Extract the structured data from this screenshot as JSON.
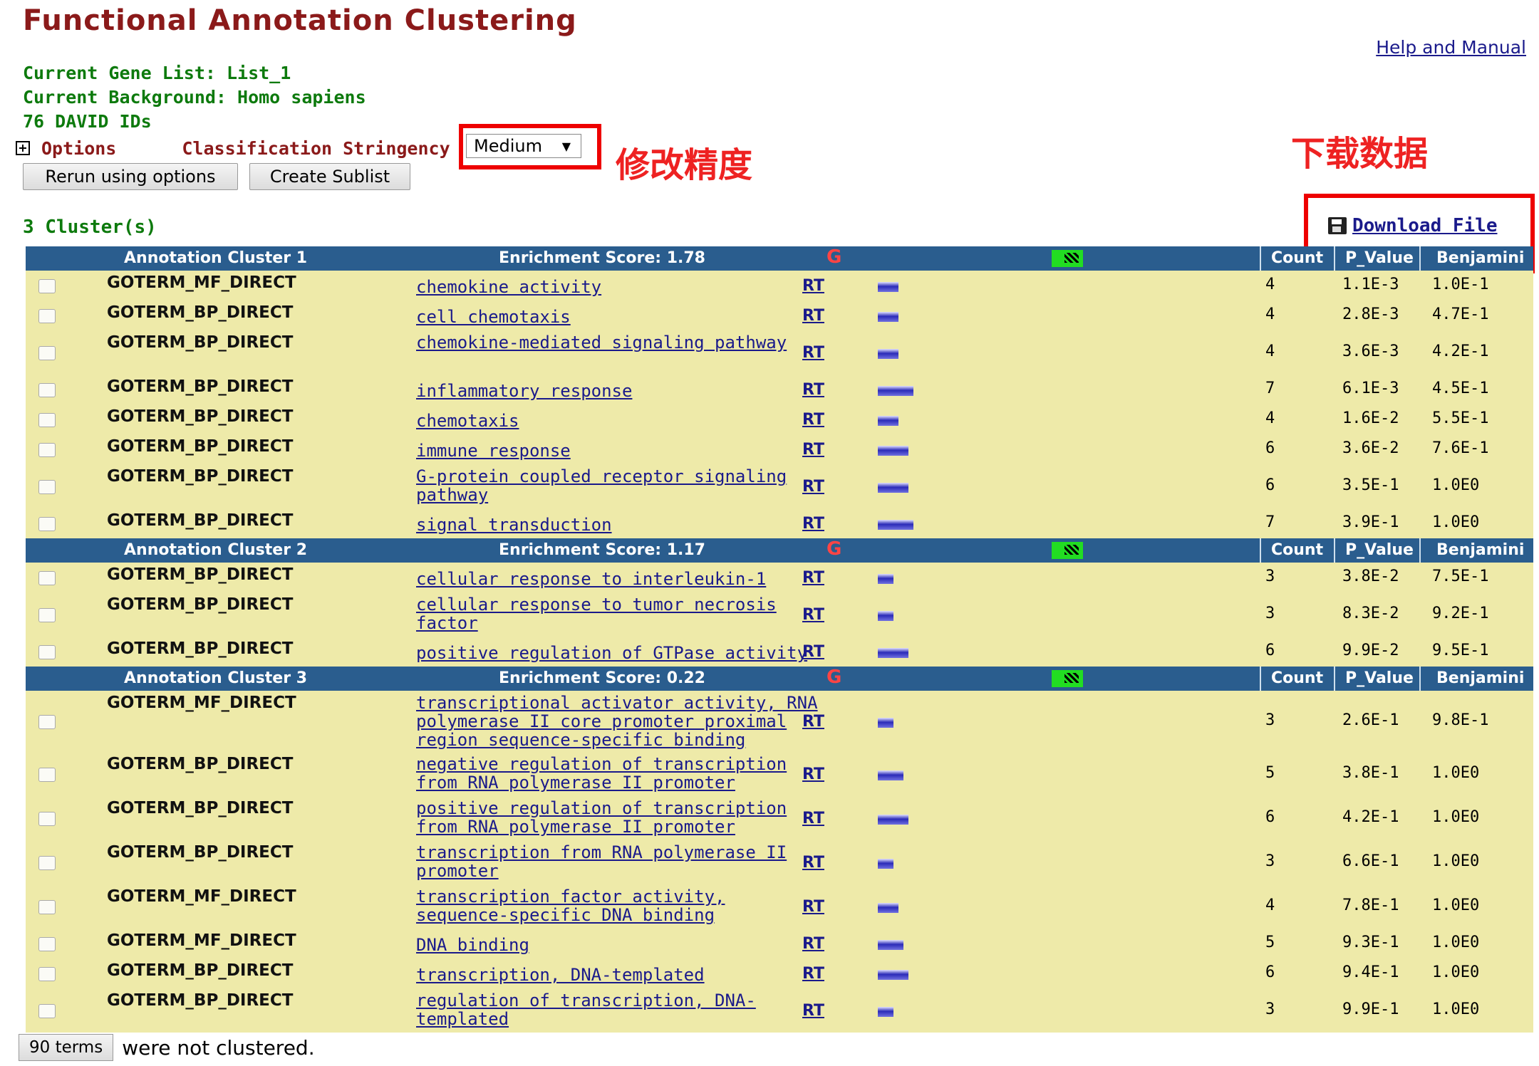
{
  "page_title": "Functional Annotation Clustering",
  "help_link": "Help and Manual",
  "info": {
    "gene_list": "Current Gene List: List_1",
    "background": "Current Background: Homo sapiens",
    "ids": "76 DAVID IDs"
  },
  "options": {
    "label": "Options",
    "stringency_label": "Classification Stringency",
    "stringency_value": "Medium"
  },
  "buttons": {
    "rerun": "Rerun using options",
    "sublist": "Create Sublist"
  },
  "annotations": {
    "modify_precision": "修改精度",
    "download_data": "下载数据"
  },
  "clusters_count": "3 Cluster(s)",
  "download_label": "Download File",
  "column_headers": {
    "count": "Count",
    "p_value": "P_Value",
    "benjamini": "Benjamini"
  },
  "accent_colors": {
    "header_bg": "#2a5d8e",
    "row_bg": "#eeeaa9",
    "title": "#8b1a1a",
    "info": "#0d7a0d",
    "annotation": "#e22222"
  },
  "clusters": [
    {
      "name": "Annotation Cluster 1",
      "score": "Enrichment Score: 1.78",
      "rows": [
        {
          "category": "GOTERM_MF_DIRECT",
          "term": "chemokine activity",
          "rt": "RT",
          "count": "4",
          "p_value": "1.1E-3",
          "benjamini": "1.0E-1"
        },
        {
          "category": "GOTERM_BP_DIRECT",
          "term": "cell chemotaxis",
          "rt": "RT",
          "count": "4",
          "p_value": "2.8E-3",
          "benjamini": "4.7E-1"
        },
        {
          "category": "GOTERM_BP_DIRECT",
          "term": "chemokine-mediated signaling pathway",
          "rt": "RT",
          "count": "4",
          "p_value": "3.6E-3",
          "benjamini": "4.2E-1"
        },
        {
          "category": "GOTERM_BP_DIRECT",
          "term": "inflammatory response",
          "rt": "RT",
          "count": "7",
          "p_value": "6.1E-3",
          "benjamini": "4.5E-1"
        },
        {
          "category": "GOTERM_BP_DIRECT",
          "term": "chemotaxis",
          "rt": "RT",
          "count": "4",
          "p_value": "1.6E-2",
          "benjamini": "5.5E-1"
        },
        {
          "category": "GOTERM_BP_DIRECT",
          "term": "immune response",
          "rt": "RT",
          "count": "6",
          "p_value": "3.6E-2",
          "benjamini": "7.6E-1"
        },
        {
          "category": "GOTERM_BP_DIRECT",
          "term": "G-protein coupled receptor signaling pathway",
          "rt": "RT",
          "count": "6",
          "p_value": "3.5E-1",
          "benjamini": "1.0E0"
        },
        {
          "category": "GOTERM_BP_DIRECT",
          "term": "signal transduction",
          "rt": "RT",
          "count": "7",
          "p_value": "3.9E-1",
          "benjamini": "1.0E0"
        }
      ]
    },
    {
      "name": "Annotation Cluster 2",
      "score": "Enrichment Score: 1.17",
      "rows": [
        {
          "category": "GOTERM_BP_DIRECT",
          "term": "cellular response to interleukin-1",
          "rt": "RT",
          "count": "3",
          "p_value": "3.8E-2",
          "benjamini": "7.5E-1"
        },
        {
          "category": "GOTERM_BP_DIRECT",
          "term": "cellular response to tumor necrosis factor",
          "rt": "RT",
          "count": "3",
          "p_value": "8.3E-2",
          "benjamini": "9.2E-1"
        },
        {
          "category": "GOTERM_BP_DIRECT",
          "term": "positive regulation of GTPase activity",
          "rt": "RT",
          "count": "6",
          "p_value": "9.9E-2",
          "benjamini": "9.5E-1"
        }
      ]
    },
    {
      "name": "Annotation Cluster 3",
      "score": "Enrichment Score: 0.22",
      "rows": [
        {
          "category": "GOTERM_MF_DIRECT",
          "term": "transcriptional activator activity, RNA polymerase II core promoter proximal region sequence-specific binding",
          "rt": "RT",
          "count": "3",
          "p_value": "2.6E-1",
          "benjamini": "9.8E-1"
        },
        {
          "category": "GOTERM_BP_DIRECT",
          "term": "negative regulation of transcription from RNA polymerase II promoter",
          "rt": "RT",
          "count": "5",
          "p_value": "3.8E-1",
          "benjamini": "1.0E0"
        },
        {
          "category": "GOTERM_BP_DIRECT",
          "term": "positive regulation of transcription from RNA polymerase II promoter",
          "rt": "RT",
          "count": "6",
          "p_value": "4.2E-1",
          "benjamini": "1.0E0"
        },
        {
          "category": "GOTERM_BP_DIRECT",
          "term": "transcription from RNA polymerase II promoter",
          "rt": "RT",
          "count": "3",
          "p_value": "6.6E-1",
          "benjamini": "1.0E0"
        },
        {
          "category": "GOTERM_MF_DIRECT",
          "term": "transcription factor activity, sequence-specific DNA binding",
          "rt": "RT",
          "count": "4",
          "p_value": "7.8E-1",
          "benjamini": "1.0E0"
        },
        {
          "category": "GOTERM_MF_DIRECT",
          "term": "DNA binding",
          "rt": "RT",
          "count": "5",
          "p_value": "9.3E-1",
          "benjamini": "1.0E0"
        },
        {
          "category": "GOTERM_BP_DIRECT",
          "term": "transcription, DNA-templated",
          "rt": "RT",
          "count": "6",
          "p_value": "9.4E-1",
          "benjamini": "1.0E0"
        },
        {
          "category": "GOTERM_BP_DIRECT",
          "term": "regulation of transcription, DNA-templated",
          "rt": "RT",
          "count": "3",
          "p_value": "9.9E-1",
          "benjamini": "1.0E0"
        }
      ]
    }
  ],
  "footer": {
    "terms_button": "90 terms",
    "text": "were not clustered."
  }
}
